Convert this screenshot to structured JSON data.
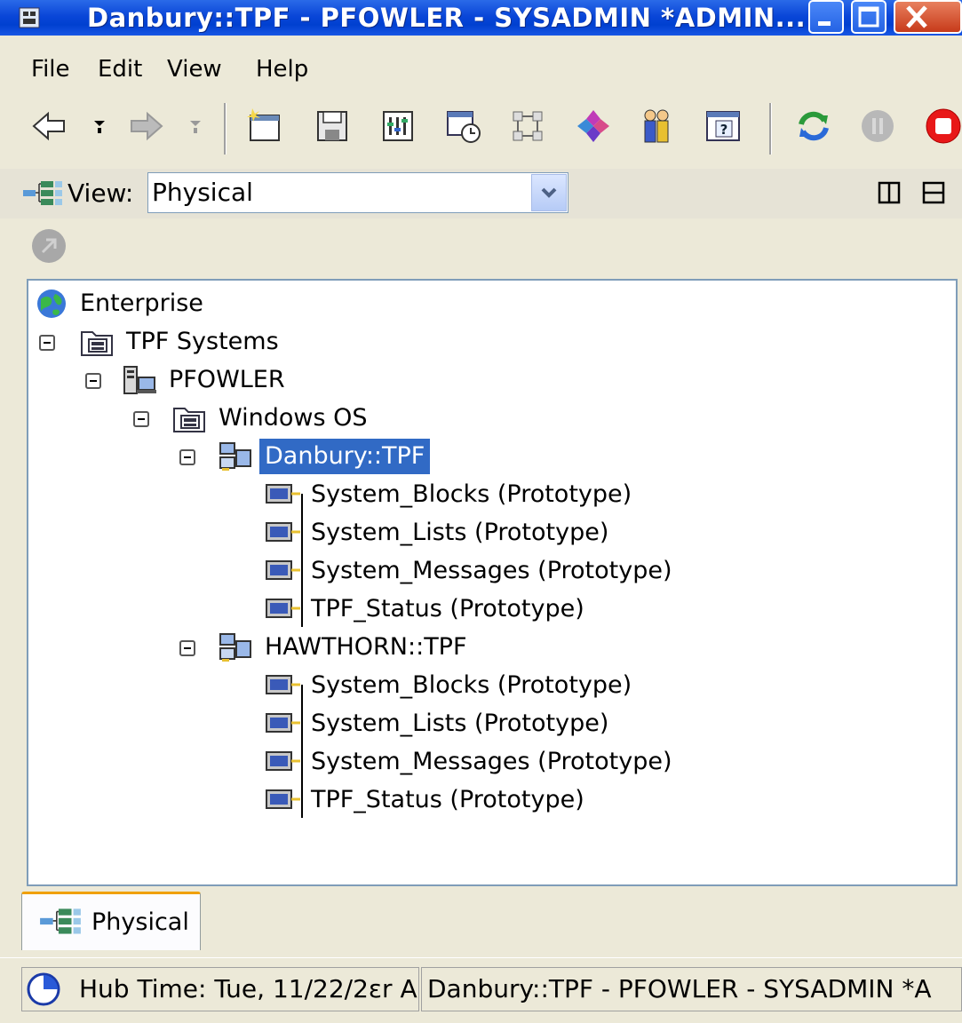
{
  "window": {
    "title": "Danbury::TPF - PFOWLER - SYSADMIN *ADMIN..."
  },
  "menu": {
    "items": [
      "File",
      "Edit",
      "View",
      "Help"
    ]
  },
  "viewbar": {
    "label": "View:",
    "selected": "Physical"
  },
  "tree": {
    "enterprise": "Enterprise",
    "tpf_systems": "TPF Systems",
    "host": "PFOWLER",
    "os": "Windows OS",
    "systems": [
      {
        "name": "Danbury::TPF",
        "selected": true,
        "children": [
          "System_Blocks (Prototype)",
          "System_Lists (Prototype)",
          "System_Messages (Prototype)",
          "TPF_Status (Prototype)"
        ]
      },
      {
        "name": "HAWTHORN::TPF",
        "selected": false,
        "children": [
          "System_Blocks (Prototype)",
          "System_Lists (Prototype)",
          "System_Messages (Prototype)",
          "TPF_Status (Prototype)"
        ]
      }
    ]
  },
  "tabs": {
    "physical": "Physical"
  },
  "status": {
    "hub_time": "Hub Time: Tue, 11/22/2ɛr A",
    "context": "Danbury::TPF - PFOWLER - SYSADMIN *A"
  },
  "icons": {
    "app": "app-icon",
    "back": "back-arrow-icon",
    "forward": "forward-arrow-icon",
    "new_window": "new-window-icon",
    "save": "save-icon",
    "properties": "properties-icon",
    "history": "history-icon",
    "workflow": "workflow-icon",
    "navigator": "navigator-icon",
    "users": "users-icon",
    "help": "help-icon",
    "refresh": "refresh-icon",
    "pause": "pause-icon",
    "stop": "stop-icon"
  },
  "colors": {
    "titlebar": "#0a46d8",
    "selection": "#316ac5",
    "tab_accent": "#f0a000"
  }
}
